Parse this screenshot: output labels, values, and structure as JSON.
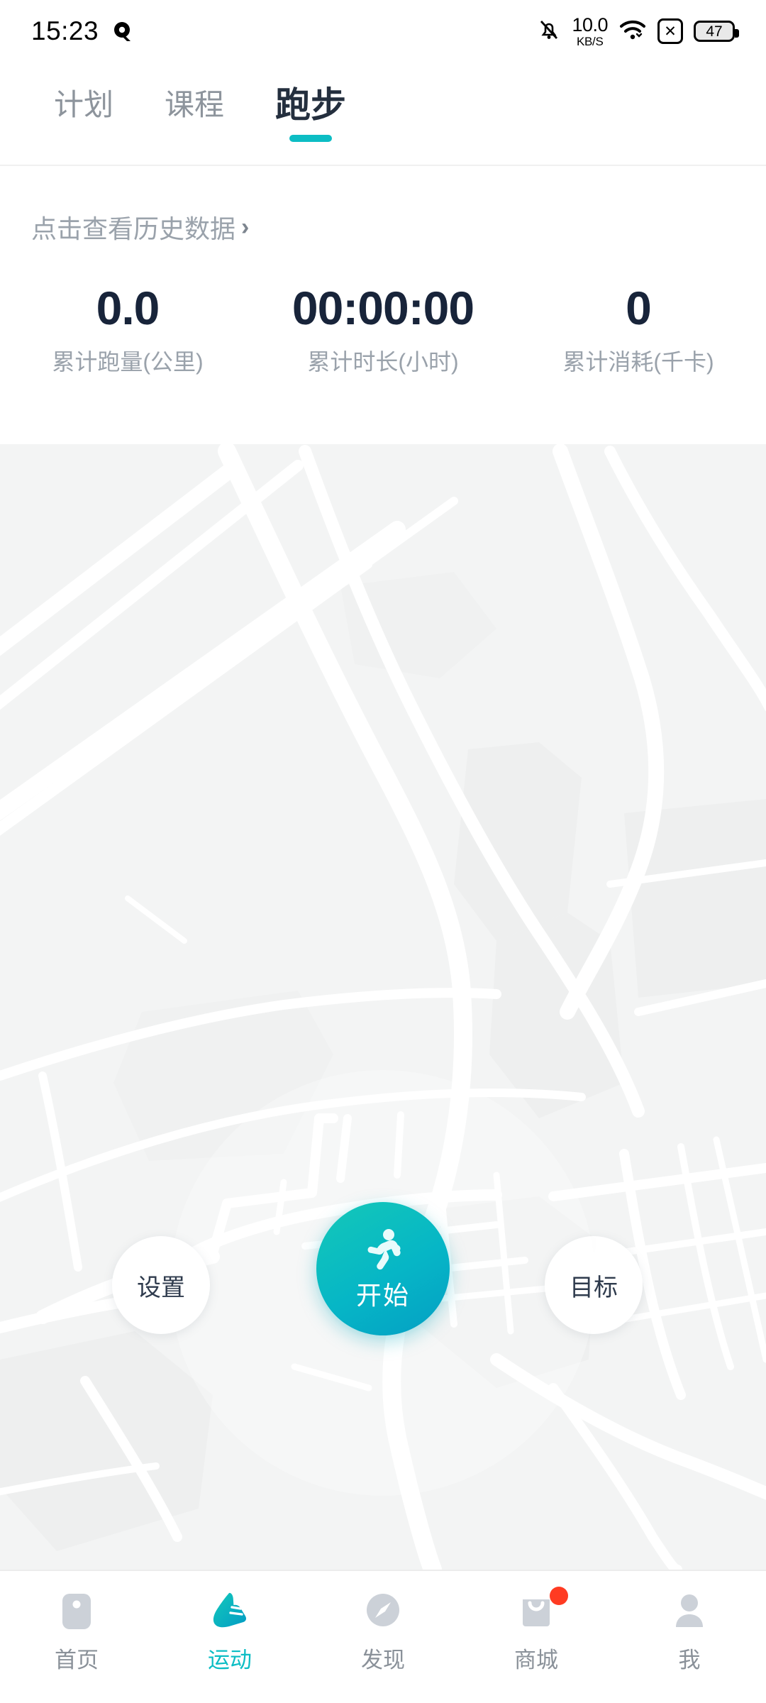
{
  "statusbar": {
    "time": "15:23",
    "app_logo_icon": "q-logo-icon",
    "mute_icon": "bell-mute-icon",
    "net_speed_value": "10.0",
    "net_speed_unit": "KB/S",
    "wifi_icon": "wifi-icon",
    "sim_icon": "sim-card-disabled-icon",
    "battery_level": "47"
  },
  "tabs": [
    {
      "label": "计划",
      "active": false
    },
    {
      "label": "课程",
      "active": false
    },
    {
      "label": "跑步",
      "active": true
    }
  ],
  "summary": {
    "history_link_text": "点击查看历史数据",
    "history_chevron": "›",
    "stats": [
      {
        "value": "0.0",
        "label": "累计跑量(公里)"
      },
      {
        "value": "00:00:00",
        "label": "累计时长(小时)"
      },
      {
        "value": "0",
        "label": "累计消耗(千卡)"
      }
    ]
  },
  "map": {
    "background_color": "#f3f4f4",
    "road_color": "#ffffff",
    "block_color": "#eeefef"
  },
  "controls": {
    "settings_label": "设置",
    "goal_label": "目标",
    "start_label": "开始",
    "start_icon": "running-person-icon",
    "accent_color": "#0cbdc4"
  },
  "bottom_nav": [
    {
      "label": "首页",
      "icon": "home-icon",
      "active": false,
      "badge": false
    },
    {
      "label": "运动",
      "icon": "running-shoe-icon",
      "active": true,
      "badge": false
    },
    {
      "label": "发现",
      "icon": "compass-icon",
      "active": false,
      "badge": false
    },
    {
      "label": "商城",
      "icon": "shopping-bag-icon",
      "active": false,
      "badge": true
    },
    {
      "label": "我",
      "icon": "person-icon",
      "active": false,
      "badge": false
    }
  ]
}
